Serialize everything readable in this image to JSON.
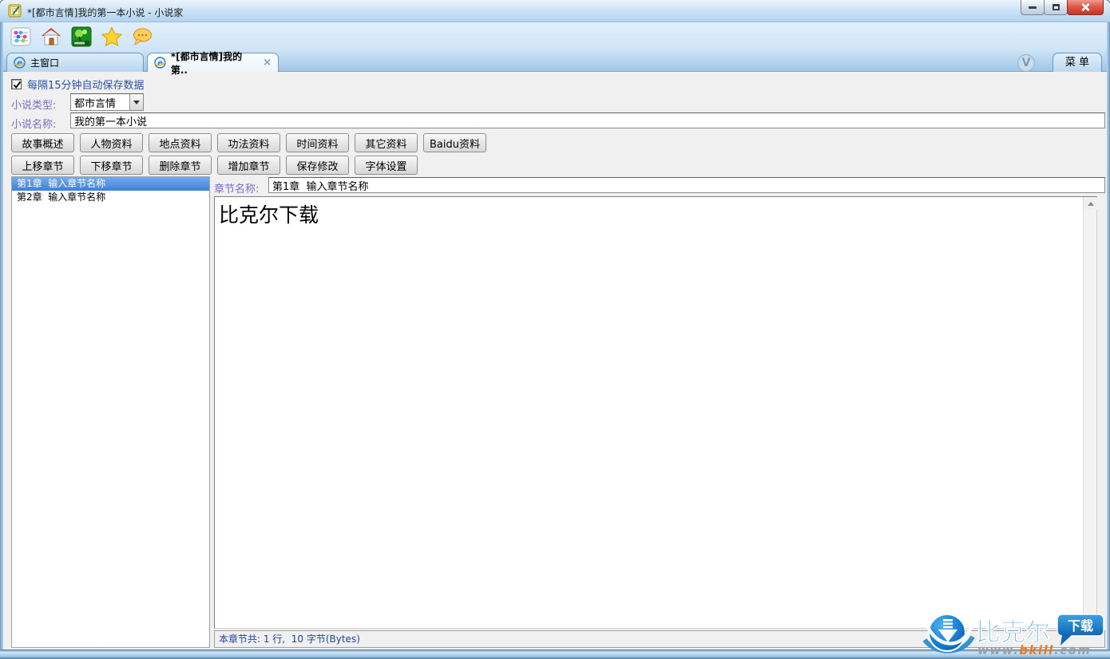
{
  "window": {
    "title": "*[都市言情]我的第一本小说 - 小说家",
    "app_icon": "notepad-pen-icon",
    "controls": [
      "minimize-button",
      "maximize-button",
      "close-button"
    ]
  },
  "toolbar": {
    "icons": [
      "abacus-icon",
      "home-icon",
      "tree-game-icon",
      "star-favorite-icon",
      "comment-bubble-icon"
    ]
  },
  "tabs": {
    "items": [
      {
        "label": "主窗口",
        "active": false
      },
      {
        "label": "*[都市言情]我的第..",
        "active": true
      }
    ],
    "close_glyph": "×",
    "dropdown_glyph": "V",
    "menu_label": "菜 单"
  },
  "form": {
    "autosave_label": "每隔15分钟自动保存数据",
    "autosave_checked": true,
    "type_label": "小说类型:",
    "type_value": "都市言情",
    "name_label": "小说名称:",
    "name_value": "我的第一本小说"
  },
  "buttons": {
    "row1": [
      "故事概述",
      "人物资料",
      "地点资料",
      "功法资料",
      "时间资料",
      "其它资料",
      "Baidu资料"
    ],
    "row2": [
      "上移章节",
      "下移章节",
      "删除章节",
      "增加章节",
      "保存修改",
      "字体设置"
    ]
  },
  "chapters": {
    "items": [
      {
        "label": "第1章  输入章节名称",
        "selected": true
      },
      {
        "label": "第2章  输入章节名称",
        "selected": false
      }
    ]
  },
  "editor": {
    "chapter_label": "章节名称:",
    "chapter_value": "第1章  输入章节名称",
    "content": "比克尔下载",
    "status": "本章节共: 1 行,  10 字节(Bytes)"
  },
  "watermark": {
    "brand": "比克尔",
    "badge": "下载",
    "url_www": "www.",
    "url_domain": "bkill",
    "url_tld": ".com"
  },
  "colors": {
    "titlebar_blue": "#cfe4f6",
    "frame_blue": "#7ca4cf",
    "label_purple": "#7b6ec6",
    "autosave_blue": "#2b4fa8",
    "status_blue": "#26439c",
    "selection_blue_top": "#74abee",
    "selection_blue_bottom": "#3f7fd8",
    "close_red": "#c23527",
    "brand_blue": "#1585d6",
    "brand_orange": "#f07818"
  }
}
